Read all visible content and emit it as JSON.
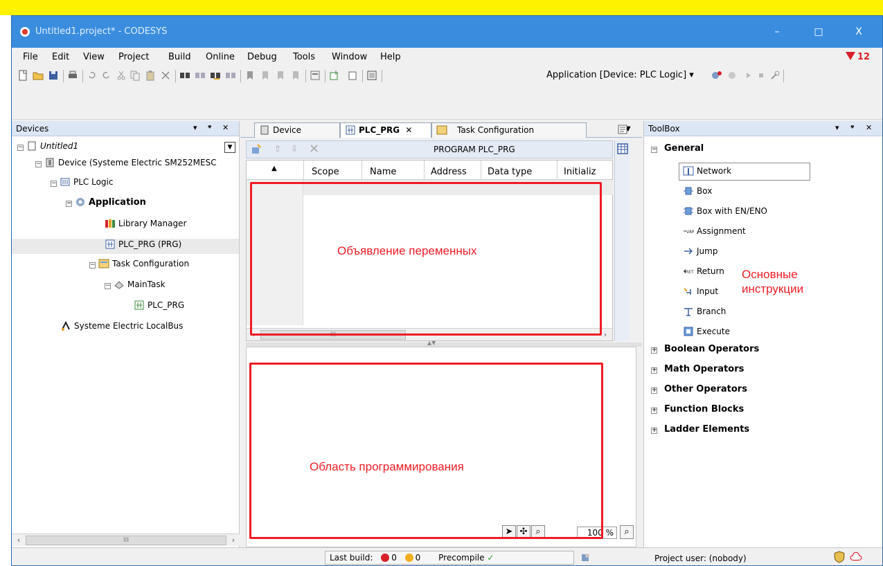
{
  "window": {
    "title": "Untitled1.project* - CODESYS",
    "minimize": "–",
    "maximize": "□",
    "close": "X"
  },
  "menu": [
    "File",
    "Edit",
    "View",
    "Project",
    "Build",
    "Online",
    "Debug",
    "Tools",
    "Window",
    "Help"
  ],
  "messages_badge": "12",
  "toolbar": {
    "active_application": "Application [Device: PLC Logic]"
  },
  "devices_panel": {
    "title": "Devices",
    "tree": {
      "root": "Untitled1",
      "device": "Device (Systeme Electric SM252MESC",
      "plc_logic": "PLC Logic",
      "application": "Application",
      "library_manager": "Library Manager",
      "plc_prg": "PLC_PRG (PRG)",
      "task_configuration": "Task Configuration",
      "main_task": "MainTask",
      "main_task_prg": "PLC_PRG",
      "local_bus": "Systeme Electric LocalBus"
    },
    "scroll_thumb": "III"
  },
  "editor": {
    "tabs": [
      "Device",
      "PLC_PRG",
      "Task Configuration"
    ],
    "active_tab_index": 1,
    "program_title": "PROGRAM PLC_PRG",
    "columns": [
      "Scope",
      "Name",
      "Address",
      "Data type",
      "Initializ"
    ],
    "scroll_thumb": "III",
    "zoom": "100 %"
  },
  "annotations": {
    "declarations": "Объявление переменных",
    "programming": "Область программирования",
    "instructions_line1": "Основные",
    "instructions_line2": "инструкции",
    "color": "#ee1c24"
  },
  "toolbox": {
    "title": "ToolBox",
    "general": "General",
    "items": [
      "Network",
      "Box",
      "Box with EN/ENO",
      "Assignment",
      "Jump",
      "Return",
      "Input",
      "Branch",
      "Execute"
    ],
    "groups": [
      "Boolean Operators",
      "Math Operators",
      "Other Operators",
      "Function Blocks",
      "Ladder Elements"
    ]
  },
  "status": {
    "last_build_label": "Last build:",
    "errors": "0",
    "warnings": "0",
    "precompile": "Precompile",
    "project_user": "Project user: (nobody)"
  },
  "colors": {
    "titlebar": "#3a8dde",
    "banner": "#fff200",
    "panel_header": "#dce6f4"
  }
}
